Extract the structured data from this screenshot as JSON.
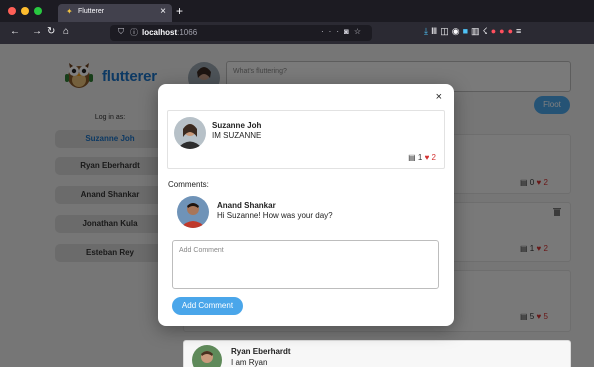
{
  "browser": {
    "tab_title": "Flutterer",
    "tab_favicon": "owl-favicon",
    "url_host": "localhost",
    "url_port": ":1066",
    "url_more": "···",
    "icons": [
      "download-icon",
      "library-icon",
      "sidebar-icon",
      "account-icon",
      "extension-icon",
      "bookmarks-icon",
      "extension-icon",
      "extension-icon",
      "extension-icon",
      "extension-icon",
      "menu-icon"
    ]
  },
  "app": {
    "logo_text": "flutterer",
    "login_label": "Log in as:",
    "users": [
      {
        "name": "Suzanne Joh",
        "active": true
      },
      {
        "name": "Ryan Eberhardt",
        "active": false
      },
      {
        "name": "Anand Shankar",
        "active": false
      },
      {
        "name": "Jonathan Kula",
        "active": false
      },
      {
        "name": "Esteban Rey",
        "active": false
      }
    ],
    "composer_placeholder": "What's fluttering?",
    "floot_label": "Floot"
  },
  "feed": {
    "cards": [
      {
        "comments": "0",
        "likes": "2"
      },
      {
        "comments": "1",
        "likes": "2"
      },
      {
        "comments": "5",
        "likes": "5"
      }
    ],
    "bottom_post": {
      "name": "Ryan Eberhardt",
      "text": "I am Ryan"
    }
  },
  "modal": {
    "close_label": "×",
    "post": {
      "name": "Suzanne Joh",
      "text": "IM SUZANNE",
      "comments": "1",
      "likes": "2"
    },
    "comments_label": "Comments:",
    "comment": {
      "name": "Anand Shankar",
      "text": "Hi Suzanne! How was your day?"
    },
    "input_placeholder": "Add Comment",
    "button_label": "Add Comment"
  },
  "colors": {
    "accent": "#4aa6ea",
    "brand": "#1a73c7",
    "heart": "#d32f2f"
  }
}
